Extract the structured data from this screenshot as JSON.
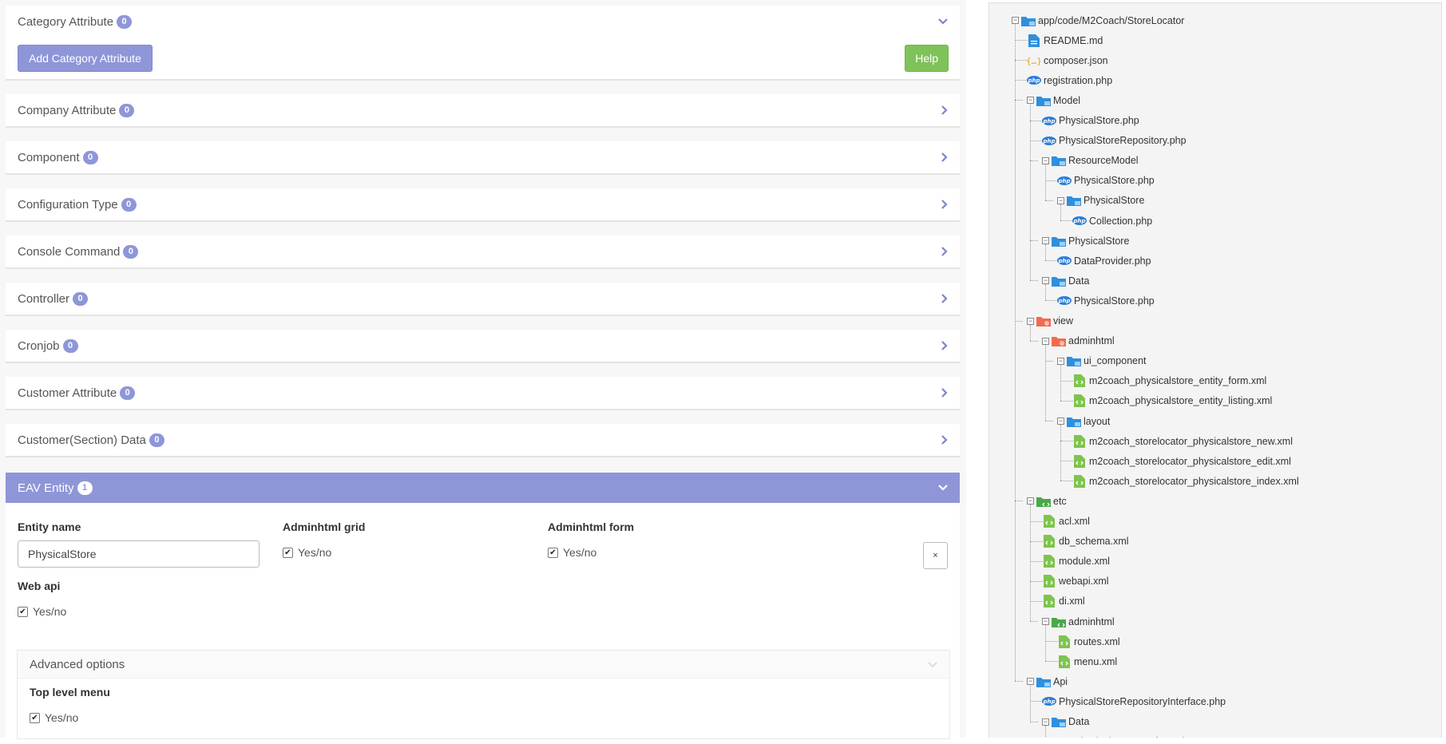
{
  "panels": [
    {
      "title": "Category Attribute",
      "count": "0",
      "add_button": "Add Category Attribute",
      "help_button": "Help"
    },
    {
      "title": "Company Attribute",
      "count": "0"
    },
    {
      "title": "Component",
      "count": "0"
    },
    {
      "title": "Configuration Type",
      "count": "0"
    },
    {
      "title": "Console Command",
      "count": "0"
    },
    {
      "title": "Controller",
      "count": "0"
    },
    {
      "title": "Cronjob",
      "count": "0"
    },
    {
      "title": "Customer Attribute",
      "count": "0"
    },
    {
      "title": "Customer(Section) Data",
      "count": "0"
    }
  ],
  "eav": {
    "title": "EAV Entity",
    "count": "1",
    "entity_name_label": "Entity name",
    "entity_name_value": "PhysicalStore",
    "grid_label": "Adminhtml grid",
    "grid_check": "Yes/no",
    "form_label": "Adminhtml form",
    "form_check": "Yes/no",
    "remove_button": "×",
    "webapi_label": "Web api",
    "webapi_check": "Yes/no",
    "advanced_title": "Advanced options",
    "toplevel_label": "Top level menu",
    "toplevel_check": "Yes/no"
  },
  "tree": [
    {
      "label": "app/code/M2Coach/StoreLocator",
      "icon": "folder-icon",
      "depth": 0,
      "toggle": "minus"
    },
    {
      "label": "README.md",
      "icon": "markdown-file-icon",
      "depth": 1
    },
    {
      "label": "composer.json",
      "icon": "json-file-icon",
      "depth": 1
    },
    {
      "label": "registration.php",
      "icon": "php-file-icon",
      "depth": 1
    },
    {
      "label": "Model",
      "icon": "folder-icon",
      "depth": 1,
      "toggle": "minus"
    },
    {
      "label": "PhysicalStore.php",
      "icon": "php-file-icon",
      "depth": 2
    },
    {
      "label": "PhysicalStoreRepository.php",
      "icon": "php-file-icon",
      "depth": 2
    },
    {
      "label": "ResourceModel",
      "icon": "folder-icon",
      "depth": 2,
      "toggle": "minus"
    },
    {
      "label": "PhysicalStore.php",
      "icon": "php-file-icon",
      "depth": 3
    },
    {
      "label": "PhysicalStore",
      "icon": "folder-icon",
      "depth": 3,
      "toggle": "minus"
    },
    {
      "label": "Collection.php",
      "icon": "php-file-icon",
      "depth": 4
    },
    {
      "label": "PhysicalStore",
      "icon": "folder-icon",
      "depth": 2,
      "toggle": "minus"
    },
    {
      "label": "DataProvider.php",
      "icon": "php-file-icon",
      "depth": 3
    },
    {
      "label": "Data",
      "icon": "folder-icon",
      "depth": 2,
      "toggle": "minus"
    },
    {
      "label": "PhysicalStore.php",
      "icon": "php-file-icon",
      "depth": 3
    },
    {
      "label": "view",
      "icon": "view-folder-icon",
      "depth": 1,
      "toggle": "minus"
    },
    {
      "label": "adminhtml",
      "icon": "view-folder-icon",
      "depth": 2,
      "toggle": "minus"
    },
    {
      "label": "ui_component",
      "icon": "folder-icon",
      "depth": 3,
      "toggle": "minus"
    },
    {
      "label": "m2coach_physicalstore_entity_form.xml",
      "icon": "xml-file-icon",
      "depth": 4
    },
    {
      "label": "m2coach_physicalstore_entity_listing.xml",
      "icon": "xml-file-icon",
      "depth": 4
    },
    {
      "label": "layout",
      "icon": "folder-icon",
      "depth": 3,
      "toggle": "minus"
    },
    {
      "label": "m2coach_storelocator_physicalstore_new.xml",
      "icon": "xml-file-icon",
      "depth": 4
    },
    {
      "label": "m2coach_storelocator_physicalstore_edit.xml",
      "icon": "xml-file-icon",
      "depth": 4
    },
    {
      "label": "m2coach_storelocator_physicalstore_index.xml",
      "icon": "xml-file-icon",
      "depth": 4
    },
    {
      "label": "etc",
      "icon": "etc-folder-icon",
      "depth": 1,
      "toggle": "minus"
    },
    {
      "label": "acl.xml",
      "icon": "xml-file-icon",
      "depth": 2
    },
    {
      "label": "db_schema.xml",
      "icon": "xml-file-icon",
      "depth": 2
    },
    {
      "label": "module.xml",
      "icon": "xml-file-icon",
      "depth": 2
    },
    {
      "label": "webapi.xml",
      "icon": "xml-file-icon",
      "depth": 2
    },
    {
      "label": "di.xml",
      "icon": "xml-file-icon",
      "depth": 2
    },
    {
      "label": "adminhtml",
      "icon": "etc-folder-icon",
      "depth": 2,
      "toggle": "minus"
    },
    {
      "label": "routes.xml",
      "icon": "xml-file-icon",
      "depth": 3
    },
    {
      "label": "menu.xml",
      "icon": "xml-file-icon",
      "depth": 3
    },
    {
      "label": "Api",
      "icon": "folder-icon",
      "depth": 1,
      "toggle": "minus"
    },
    {
      "label": "PhysicalStoreRepositoryInterface.php",
      "icon": "php-file-icon",
      "depth": 2
    },
    {
      "label": "Data",
      "icon": "folder-icon",
      "depth": 2,
      "toggle": "minus"
    },
    {
      "label": "PhysicalStoreInterface.php",
      "icon": "php-file-icon",
      "depth": 3
    }
  ]
}
